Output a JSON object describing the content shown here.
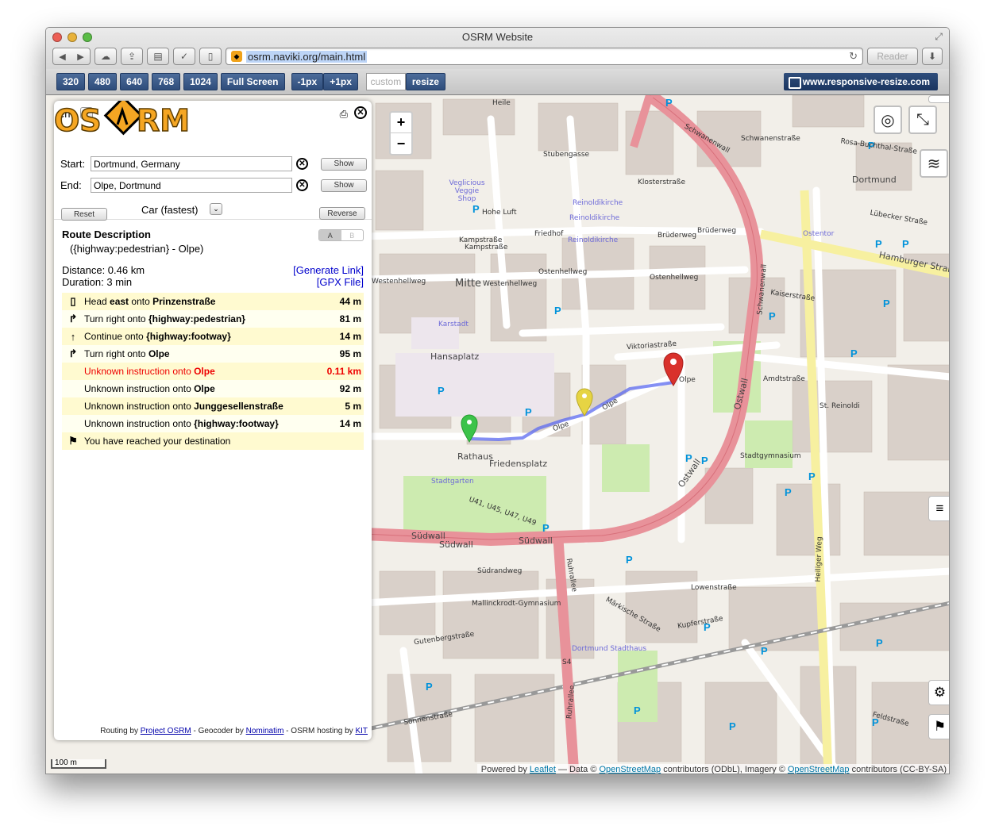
{
  "window": {
    "title": "OSRM Website"
  },
  "browser": {
    "url": "osrm.naviki.org/main.html",
    "reader_label": "Reader"
  },
  "responsive_bar": {
    "buttons": [
      "320",
      "480",
      "640",
      "768",
      "1024",
      "Full Screen",
      "-1px",
      "+1px"
    ],
    "custom_placeholder": "custom",
    "resize_label": "resize",
    "site_label": "www.responsive-resize.com"
  },
  "panel": {
    "language": "en",
    "logo_text": "OSRM",
    "start_label": "Start:",
    "start_value": "Dortmund, Germany",
    "end_label": "End:",
    "end_value": "Olpe, Dortmund",
    "show_label": "Show",
    "reset_label": "Reset",
    "reverse_label": "Reverse",
    "profile": "Car (fastest)"
  },
  "route": {
    "title": "Route Description",
    "subtitle": "({highway:pedestrian} - Olpe)",
    "toggle_a": "A",
    "toggle_b": "B",
    "distance": "Distance: 0.46 km",
    "duration": "Duration: 3 min",
    "generate_link": "[Generate Link]",
    "gpx_file": "[GPX File]",
    "instructions": [
      {
        "icon": "traffic-light-icon",
        "glyph": "▯",
        "prefix": "Head ",
        "bold1": "east",
        "mid": " onto ",
        "bold2": "Prinzenstraße",
        "dist": "44 m"
      },
      {
        "icon": "turn-right-icon",
        "glyph": "↱",
        "prefix": "Turn right onto ",
        "bold1": "",
        "mid": "",
        "bold2": "{highway:pedestrian}",
        "dist": "81 m"
      },
      {
        "icon": "straight-icon",
        "glyph": "↑",
        "prefix": "Continue onto ",
        "bold1": "",
        "mid": "",
        "bold2": "{highway:footway}",
        "dist": "14 m"
      },
      {
        "icon": "turn-right-icon",
        "glyph": "↱",
        "prefix": "Turn right onto ",
        "bold1": "",
        "mid": "",
        "bold2": "Olpe",
        "dist": "95 m"
      },
      {
        "icon": "",
        "glyph": "",
        "prefix": "Unknown instruction onto ",
        "bold1": "",
        "mid": "",
        "bold2": "Olpe",
        "dist": "0.11 km",
        "highlight": true
      },
      {
        "icon": "",
        "glyph": "",
        "prefix": "Unknown instruction onto ",
        "bold1": "",
        "mid": "",
        "bold2": "Olpe",
        "dist": "92 m"
      },
      {
        "icon": "",
        "glyph": "",
        "prefix": "Unknown instruction onto ",
        "bold1": "",
        "mid": "",
        "bold2": "Junggesellenstraße",
        "dist": "5 m"
      },
      {
        "icon": "",
        "glyph": "",
        "prefix": "Unknown instruction onto ",
        "bold1": "",
        "mid": "",
        "bold2": "{highway:footway}",
        "dist": "14 m"
      },
      {
        "icon": "flag-icon",
        "glyph": "⚑",
        "prefix": "You have reached your destination",
        "bold1": "",
        "mid": "",
        "bold2": "",
        "dist": ""
      }
    ]
  },
  "credits": {
    "routing_by": "Routing by ",
    "project_osrm": "Project OSRM",
    "geocoder_by": " - Geocoder by ",
    "nominatim": "Nominatim",
    "hosting_by": " - OSRM hosting by ",
    "kit": "KIT"
  },
  "map": {
    "scale": "100 m",
    "attribution": {
      "powered_by": "Powered by ",
      "leaflet": "Leaflet",
      "data": " — Data © ",
      "osm1": "OpenStreetMap",
      "contrib1": " contributors (ODbL), Imagery © ",
      "osm2": "OpenStreetMap",
      "contrib2": " contributors (CC-BY-SA)"
    },
    "labels": [
      {
        "text": "Heile",
        "cls": ""
      },
      {
        "text": "Stubengasse",
        "cls": ""
      },
      {
        "text": "Veglicious Veggie Shop",
        "cls": "blue"
      },
      {
        "text": "Hohe Luft",
        "cls": ""
      },
      {
        "text": "Reinoldikirche",
        "cls": "blue"
      },
      {
        "text": "Reinoldikirche",
        "cls": "blue"
      },
      {
        "text": "Reinoldikirche",
        "cls": "blue"
      },
      {
        "text": "Kampstraße",
        "cls": ""
      },
      {
        "text": "Kampstraße",
        "cls": ""
      },
      {
        "text": "Friedhof",
        "cls": ""
      },
      {
        "text": "Klosterstraße",
        "cls": ""
      },
      {
        "text": "Brüderweg",
        "cls": ""
      },
      {
        "text": "Brüderweg",
        "cls": ""
      },
      {
        "text": "Schwanenwall",
        "cls": ""
      },
      {
        "text": "Schwanenwall",
        "cls": ""
      },
      {
        "text": "Schwanenstraße",
        "cls": ""
      },
      {
        "text": "Rosa-Buchthal-Straße",
        "cls": ""
      },
      {
        "text": "Dortmund",
        "cls": ""
      },
      {
        "text": "Lübecker Straße",
        "cls": ""
      },
      {
        "text": "Ostentor",
        "cls": "blue"
      },
      {
        "text": "Hamburger Straße",
        "cls": "big"
      },
      {
        "text": "Mitte",
        "cls": "big"
      },
      {
        "text": "Westenhellweg",
        "cls": ""
      },
      {
        "text": "Westenhellweg",
        "cls": ""
      },
      {
        "text": "Ostenhellweg",
        "cls": ""
      },
      {
        "text": "Ostenhellweg",
        "cls": ""
      },
      {
        "text": "Kaiserstraße",
        "cls": ""
      },
      {
        "text": "Karstadt",
        "cls": "blue"
      },
      {
        "text": "Hansaplatz",
        "cls": "big"
      },
      {
        "text": "Viktoriastraße",
        "cls": ""
      },
      {
        "text": "Olpe",
        "cls": ""
      },
      {
        "text": "Olpe",
        "cls": ""
      },
      {
        "text": "Olpe",
        "cls": ""
      },
      {
        "text": "Amdtstraße",
        "cls": ""
      },
      {
        "text": "St. Reinoldi",
        "cls": ""
      },
      {
        "text": "Rathaus",
        "cls": "big"
      },
      {
        "text": "Friedensplatz",
        "cls": "big"
      },
      {
        "text": "Stadtgymnasium",
        "cls": ""
      },
      {
        "text": "Stadtgarten",
        "cls": "blue"
      },
      {
        "text": "U41, U45, U47, U49",
        "cls": ""
      },
      {
        "text": "Südwall",
        "cls": "big"
      },
      {
        "text": "Südwall",
        "cls": "big"
      },
      {
        "text": "Südwall",
        "cls": "big"
      },
      {
        "text": "Südrandweg",
        "cls": ""
      },
      {
        "text": "Mallinckrodt-Gymnasium",
        "cls": ""
      },
      {
        "text": "Lowenstraße",
        "cls": ""
      },
      {
        "text": "Kupferstraße",
        "cls": ""
      },
      {
        "text": "Märkische Straße",
        "cls": ""
      },
      {
        "text": "Dortmund Stadthaus",
        "cls": "blue"
      },
      {
        "text": "S4",
        "cls": ""
      },
      {
        "text": "Gutenbergstraße",
        "cls": ""
      },
      {
        "text": "Sonnenstraße",
        "cls": ""
      },
      {
        "text": "Heiliger Weg",
        "cls": ""
      },
      {
        "text": "Feldstraße",
        "cls": ""
      },
      {
        "text": "Ostwall",
        "cls": "big"
      },
      {
        "text": "Ostwall",
        "cls": "big"
      },
      {
        "text": "Ruhrallee",
        "cls": ""
      },
      {
        "text": "Ruhrallee",
        "cls": ""
      }
    ]
  },
  "colors": {
    "route": "#5b6af0",
    "marker_start": "#3cc34a",
    "marker_via": "#e6d443",
    "marker_end": "#d9312c",
    "ring_road": "#e8929a",
    "highlight_text": "#ee0000"
  }
}
